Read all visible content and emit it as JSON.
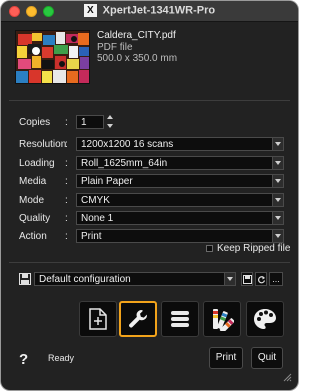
{
  "window": {
    "title": "XpertJet-1341WR-Pro",
    "app_icon_glyph": "X"
  },
  "file": {
    "name": "Caldera_CITY.pdf",
    "type": "PDF file",
    "size": "500.0 x 350.0 mm"
  },
  "form": {
    "colon": ":",
    "copies": {
      "label": "Copies",
      "value": "1"
    },
    "resolution": {
      "label": "Resolution",
      "value": "1200x1200 16 scans"
    },
    "loading": {
      "label": "Loading",
      "value": "Roll_1625mm_64in"
    },
    "media": {
      "label": "Media",
      "value": "Plain Paper"
    },
    "mode": {
      "label": "Mode",
      "value": "CMYK"
    },
    "quality": {
      "label": "Quality",
      "value": "None 1"
    },
    "action": {
      "label": "Action",
      "value": "Print"
    },
    "keep_ripped": {
      "label": "Keep Ripped file",
      "checked": false
    }
  },
  "config": {
    "value": "Default configuration",
    "more_label": "..."
  },
  "toolbar": {
    "buttons": [
      {
        "name": "add-page",
        "icon": "page-plus-icon",
        "active": false
      },
      {
        "name": "tools",
        "icon": "wrench-icon",
        "active": true
      },
      {
        "name": "list",
        "icon": "list-icon",
        "active": false
      },
      {
        "name": "color-swatches",
        "icon": "swatches-icon",
        "active": false
      },
      {
        "name": "palette",
        "icon": "palette-icon",
        "active": false
      }
    ],
    "active_color": "#f2a31b"
  },
  "footer": {
    "help_glyph": "?",
    "status": "Ready",
    "print_label": "Print",
    "quit_label": "Quit"
  }
}
